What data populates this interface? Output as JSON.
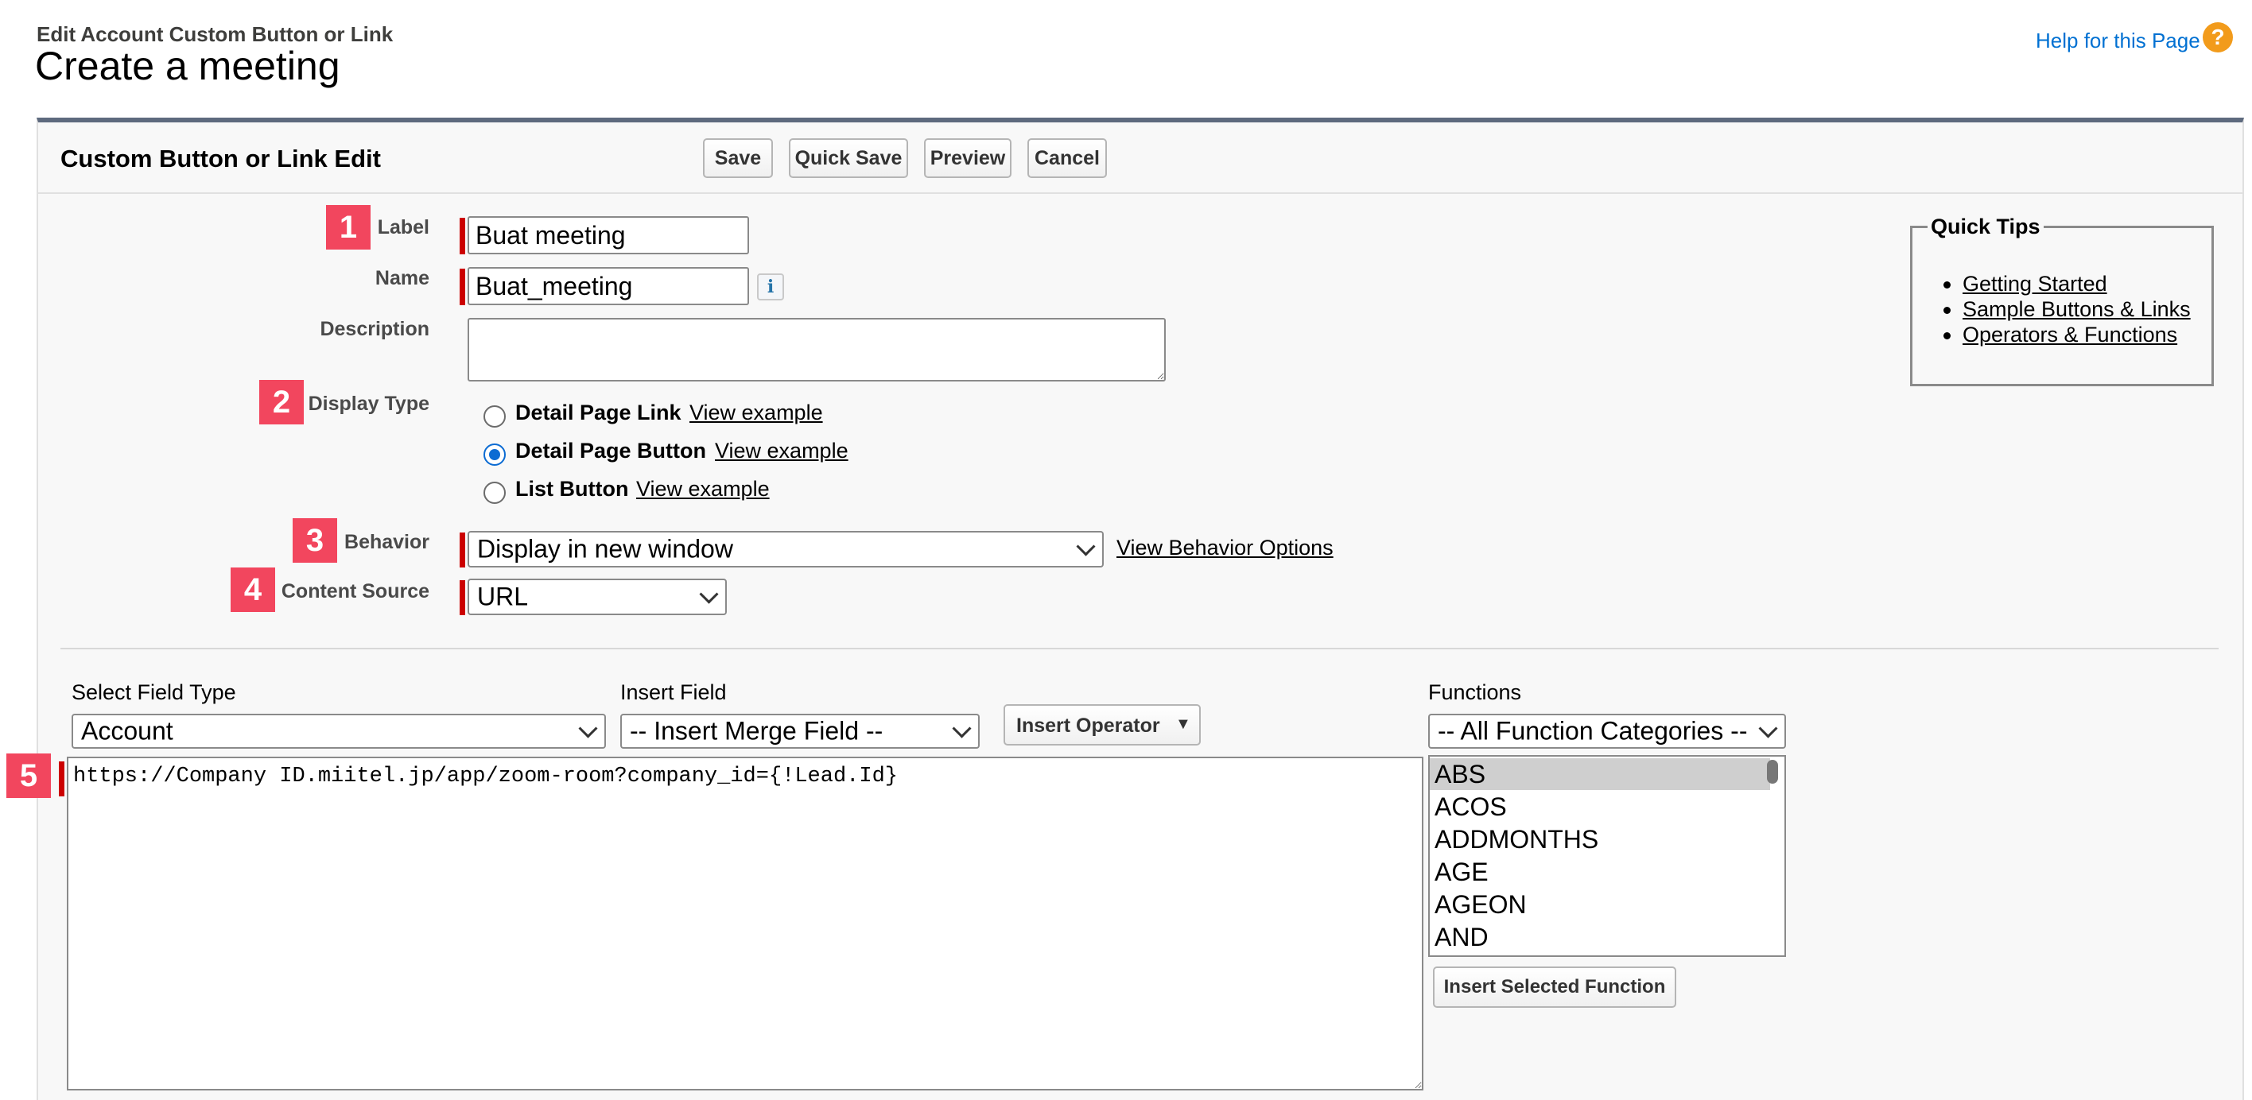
{
  "header": {
    "subtitle": "Edit Account Custom Button or Link",
    "title": "Create a meeting",
    "help_link": "Help for this Page",
    "help_icon": "question-circle-icon"
  },
  "panel": {
    "title": "Custom Button or Link Edit",
    "buttons": {
      "save": "Save",
      "quick_save": "Quick Save",
      "preview": "Preview",
      "cancel": "Cancel"
    }
  },
  "badges": [
    "1",
    "2",
    "3",
    "4",
    "5"
  ],
  "form": {
    "label": {
      "caption": "Label",
      "value": "Buat meeting"
    },
    "name": {
      "caption": "Name",
      "value": "Buat_meeting",
      "info_icon": "info-icon"
    },
    "description": {
      "caption": "Description",
      "value": ""
    },
    "display_type": {
      "caption": "Display Type",
      "options": [
        {
          "label": "Detail Page Link",
          "link": "View example",
          "selected": false
        },
        {
          "label": "Detail Page Button",
          "link": "View example",
          "selected": true
        },
        {
          "label": "List Button",
          "link": "View example",
          "selected": false
        }
      ]
    },
    "behavior": {
      "caption": "Behavior",
      "value": "Display in new window",
      "link": "View Behavior Options"
    },
    "content_source": {
      "caption": "Content Source",
      "value": "URL"
    }
  },
  "quick_tips": {
    "title": "Quick Tips",
    "items": [
      "Getting Started",
      "Sample Buttons & Links",
      "Operators & Functions"
    ]
  },
  "formula": {
    "field_type": {
      "caption": "Select Field Type",
      "value": "Account"
    },
    "insert_field": {
      "caption": "Insert Field",
      "value": "-- Insert Merge Field --"
    },
    "insert_operator": "Insert Operator",
    "url": "https://Company ID.miitel.jp/app/zoom-room?company_id={!Lead.Id}",
    "functions": {
      "caption": "Functions",
      "category": "-- All Function Categories --",
      "list": [
        "ABS",
        "ACOS",
        "ADDMONTHS",
        "AGE",
        "AGEON",
        "AND"
      ],
      "insert_button": "Insert Selected Function"
    }
  },
  "colors": {
    "badge": "#f2465e",
    "required": "#cc0000",
    "link_blue": "#0070d2",
    "help_orange": "#f29b1b"
  }
}
